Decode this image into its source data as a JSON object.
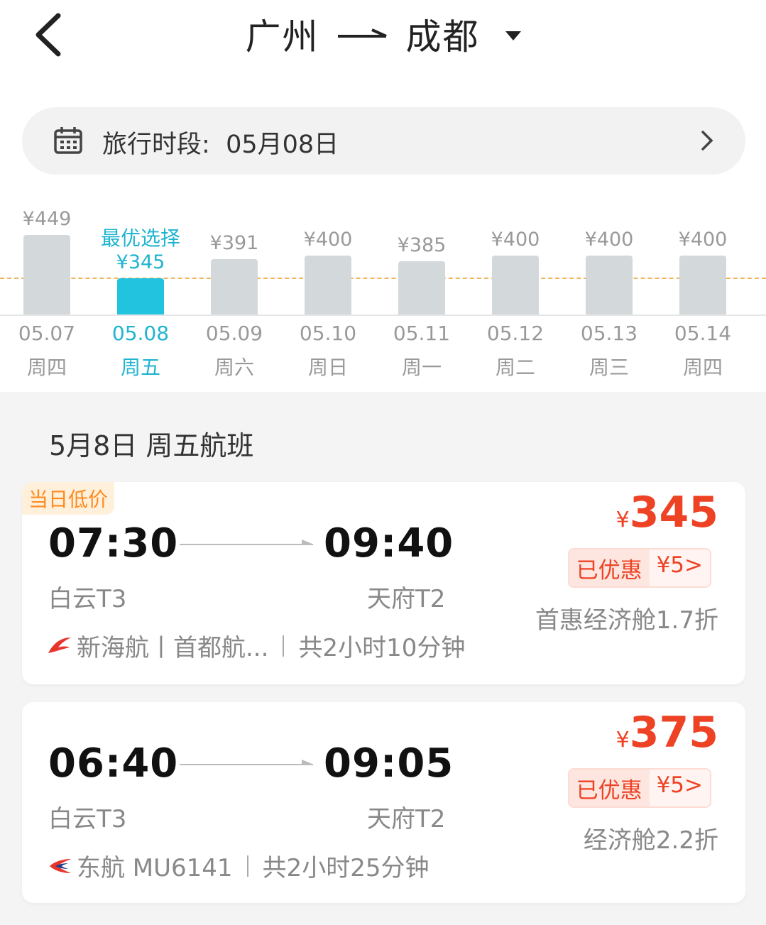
{
  "header": {
    "from": "广州",
    "to": "成都"
  },
  "date_bar": {
    "label": "旅行时段:",
    "value": "05月08日"
  },
  "calendar": {
    "best_label": "最优选择",
    "days": [
      {
        "date": "05.07",
        "weekday": "周四",
        "price": "¥449",
        "value": 449,
        "selected": false
      },
      {
        "date": "05.08",
        "weekday": "周五",
        "price": "¥345",
        "value": 345,
        "selected": true
      },
      {
        "date": "05.09",
        "weekday": "周六",
        "price": "¥391",
        "value": 391,
        "selected": false
      },
      {
        "date": "05.10",
        "weekday": "周日",
        "price": "¥400",
        "value": 400,
        "selected": false
      },
      {
        "date": "05.11",
        "weekday": "周一",
        "price": "¥385",
        "value": 385,
        "selected": false
      },
      {
        "date": "05.12",
        "weekday": "周二",
        "price": "¥400",
        "value": 400,
        "selected": false
      },
      {
        "date": "05.13",
        "weekday": "周三",
        "price": "¥400",
        "value": 400,
        "selected": false
      },
      {
        "date": "05.14",
        "weekday": "周四",
        "price": "¥400",
        "value": 400,
        "selected": false
      }
    ]
  },
  "section_title": "5月8日 周五航班",
  "flights": [
    {
      "tag": "当日低价",
      "depart_time": "07:30",
      "arrive_time": "09:40",
      "depart_airport": "白云T3",
      "arrive_airport": "天府T2",
      "airline": "新海航丨首都航...",
      "duration": "共2小时10分钟",
      "currency": "¥",
      "price": "345",
      "discount_label": "已优惠",
      "discount_value": "¥5>",
      "cabin": "首惠经济舱1.7折"
    },
    {
      "tag": "",
      "depart_time": "06:40",
      "arrive_time": "09:05",
      "depart_airport": "白云T3",
      "arrive_airport": "天府T2",
      "airline": "东航 MU6141",
      "duration": "共2小时25分钟",
      "currency": "¥",
      "price": "375",
      "discount_label": "已优惠",
      "discount_value": "¥5>",
      "cabin": "经济舱2.2折"
    }
  ],
  "colors": {
    "accent": "#22c3df",
    "price": "#ee4224",
    "tag": "#ff8a1e"
  }
}
